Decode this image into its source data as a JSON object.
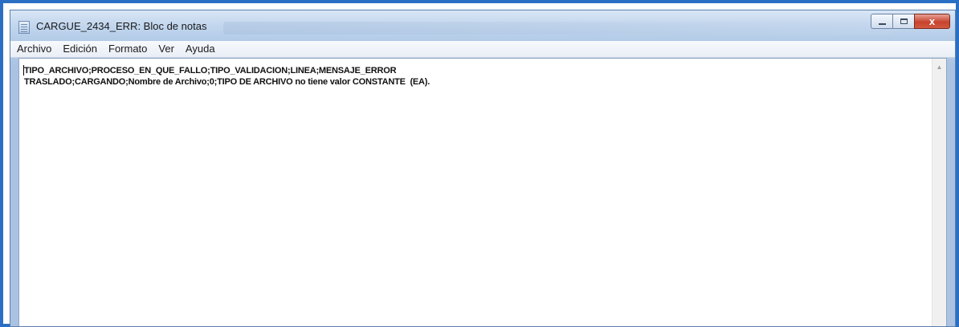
{
  "window": {
    "title": "CARGUE_2434_ERR: Bloc de notas",
    "close_glyph": "x"
  },
  "menu": [
    {
      "label": "Archivo"
    },
    {
      "label": "Edición"
    },
    {
      "label": "Formato"
    },
    {
      "label": "Ver"
    },
    {
      "label": "Ayuda"
    }
  ],
  "document": {
    "lines": [
      "TIPO_ARCHIVO;PROCESO_EN_QUE_FALLO;TIPO_VALIDACION;LINEA;MENSAJE_ERROR",
      "TRASLADO;CARGANDO;Nombre de Archivo;0;TIPO DE ARCHIVO no tiene valor CONSTANTE  (EA)."
    ]
  },
  "icons": {
    "app": "notepad-icon",
    "minimize": "minimize-icon",
    "maximize": "maximize-icon",
    "close": "close-icon",
    "scroll_up": "scroll-up-arrow-icon"
  },
  "colors": {
    "outer_border": "#2b6fc4",
    "close_button": "#c7432e"
  }
}
